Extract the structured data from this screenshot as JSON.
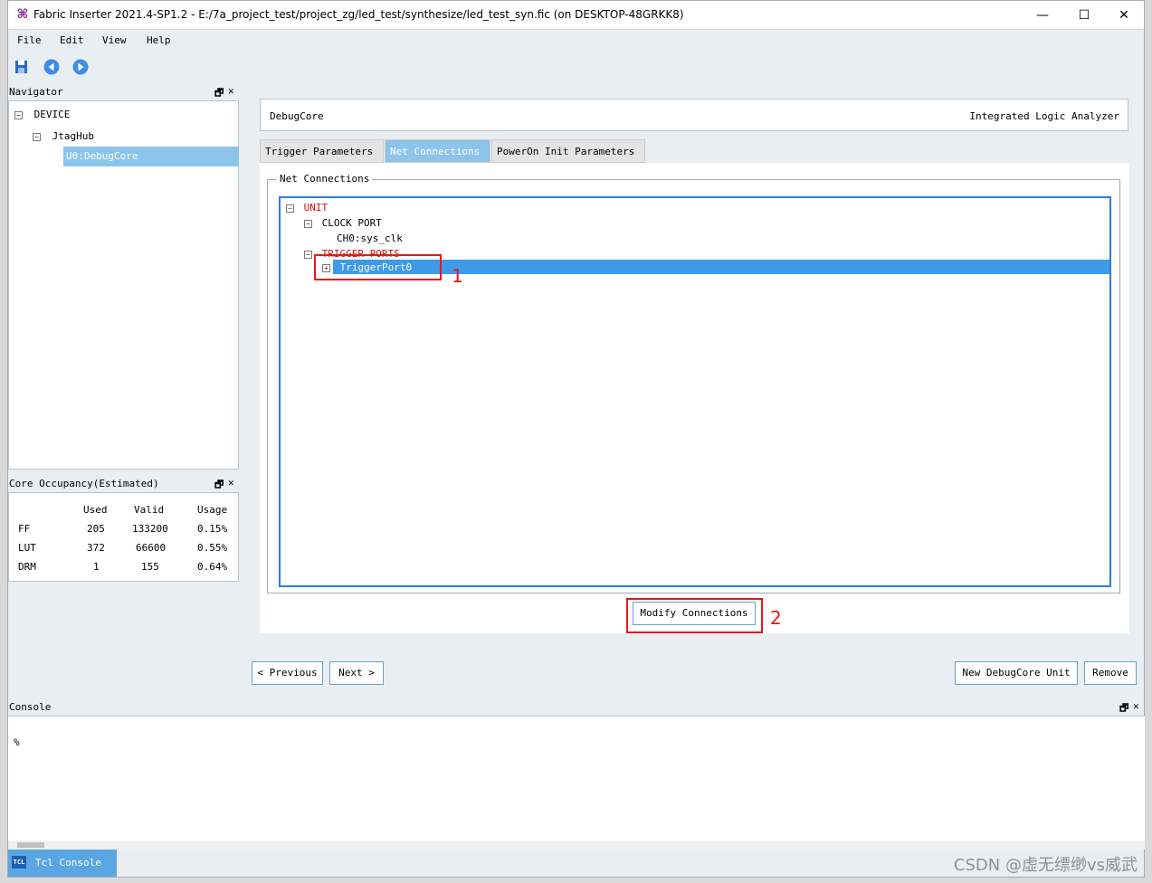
{
  "window": {
    "title": "Fabric Inserter 2021.4-SP1.2 - E:/7a_project_test/project_zg/led_test/synthesize/led_test_syn.fic (on DESKTOP-48GRKK8)",
    "minimize": "—",
    "maximize": "☐",
    "close": "✕"
  },
  "menu": [
    "File",
    "Edit",
    "View",
    "Help"
  ],
  "navigator": {
    "title": "Navigator",
    "tree": {
      "device": "DEVICE",
      "hub": "JtagHub",
      "core": "U0:DebugCore"
    }
  },
  "occupancy": {
    "title": "Core Occupancy(Estimated)",
    "headers": [
      "",
      "Used",
      "Valid",
      "Usage"
    ],
    "rows": [
      [
        "FF",
        "205",
        "133200",
        "0.15%"
      ],
      [
        "LUT",
        "372",
        "66600",
        "0.55%"
      ],
      [
        "DRM",
        "1",
        "155",
        "0.64%"
      ]
    ]
  },
  "main": {
    "header_left": "DebugCore",
    "header_right": "Integrated Logic Analyzer",
    "tabs": [
      "Trigger Parameters",
      "Net Connections",
      "PowerOn Init Parameters"
    ],
    "active_tab": 1,
    "fieldset_title": "Net Connections",
    "tree": {
      "unit": "UNIT",
      "clock_port": "CLOCK PORT",
      "ch0": "CH0:sys_clk",
      "trigger_ports": "TRIGGER PORTS",
      "trigger_port0": "TriggerPort0"
    },
    "modify_button": "Modify Connections"
  },
  "nav_buttons": {
    "previous": "< Previous",
    "next": "Next >",
    "new_core": "New DebugCore Unit",
    "remove": "Remove"
  },
  "console": {
    "title": "Console",
    "prompt": "%",
    "tab": "Tcl Console",
    "tab_icon": "TCL"
  },
  "annotations": [
    "1",
    "2"
  ],
  "watermark": "CSDN @虚无缥缈vs威武",
  "colors": {
    "accent": "#3d9be9",
    "tab_active": "#8cc4ec",
    "highlight_red": "#e01a1a",
    "tree_red": "#d01010"
  }
}
